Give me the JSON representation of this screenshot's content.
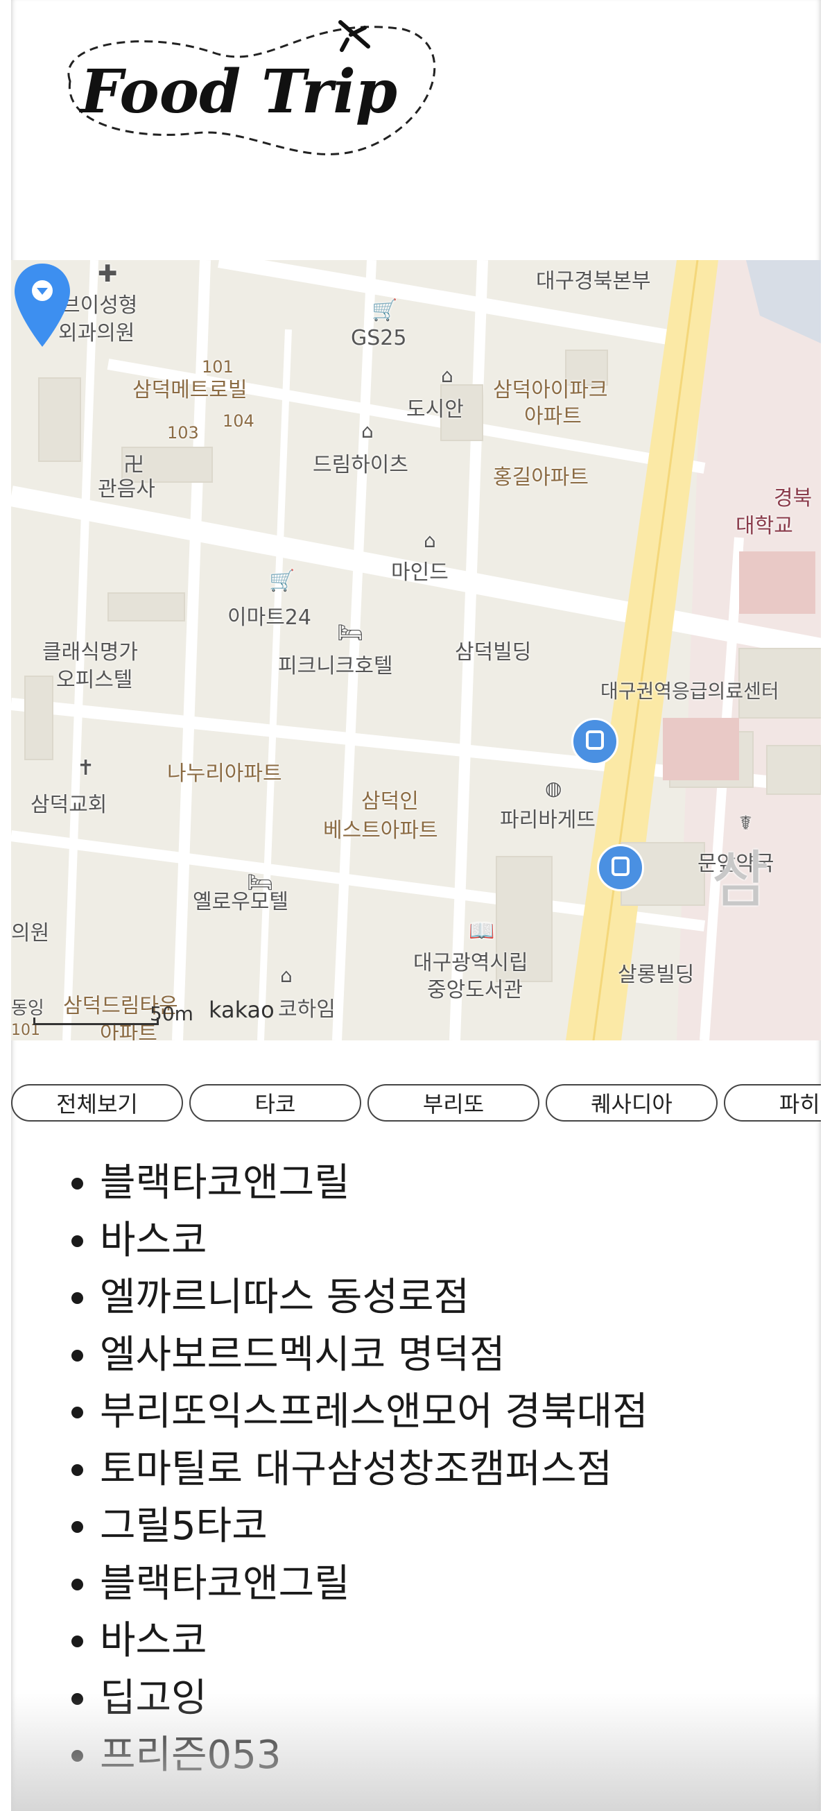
{
  "header": {
    "logo_text": "Food Trip"
  },
  "map": {
    "labels": [
      {
        "text": "대구경북본부",
        "cls": ""
      },
      {
        "text": "브이성형",
        "cls": ""
      },
      {
        "text": "외과의원",
        "cls": ""
      },
      {
        "text": "GS25",
        "cls": ""
      },
      {
        "text": "101",
        "cls": "brown"
      },
      {
        "text": "삼덕메트로빌",
        "cls": "brown"
      },
      {
        "text": "104",
        "cls": "brown"
      },
      {
        "text": "103",
        "cls": "brown"
      },
      {
        "text": "도시안",
        "cls": ""
      },
      {
        "text": "삼덕아이파크",
        "cls": "brown"
      },
      {
        "text": "아파트",
        "cls": "brown"
      },
      {
        "text": "드림하이츠",
        "cls": ""
      },
      {
        "text": "홍길아파트",
        "cls": "brown"
      },
      {
        "text": "관음사",
        "cls": ""
      },
      {
        "text": "경북",
        "cls": "red"
      },
      {
        "text": "대학교",
        "cls": "red"
      },
      {
        "text": "마인드",
        "cls": ""
      },
      {
        "text": "이마트24",
        "cls": ""
      },
      {
        "text": "클래식명가",
        "cls": ""
      },
      {
        "text": "오피스텔",
        "cls": ""
      },
      {
        "text": "피크니크호텔",
        "cls": ""
      },
      {
        "text": "삼덕빌딩",
        "cls": ""
      },
      {
        "text": "대구권역응급의료센터",
        "cls": ""
      },
      {
        "text": "나누리아파트",
        "cls": "brown"
      },
      {
        "text": "삼덕교회",
        "cls": ""
      },
      {
        "text": "삼덕인",
        "cls": "brown"
      },
      {
        "text": "베스트아파트",
        "cls": "brown"
      },
      {
        "text": "파리바게뜨",
        "cls": ""
      },
      {
        "text": "문앞약국",
        "cls": ""
      },
      {
        "text": "삼",
        "cls": "grey"
      },
      {
        "text": "옐로우모텔",
        "cls": ""
      },
      {
        "text": "의원",
        "cls": ""
      },
      {
        "text": "대구광역시립",
        "cls": ""
      },
      {
        "text": "중앙도서관",
        "cls": ""
      },
      {
        "text": "살롱빌딩",
        "cls": ""
      },
      {
        "text": "삼덕드림타운",
        "cls": "brown"
      },
      {
        "text": "아파트",
        "cls": "brown"
      },
      {
        "text": "코하임",
        "cls": ""
      },
      {
        "text": "101",
        "cls": "brown"
      },
      {
        "text": "동잉",
        "cls": ""
      }
    ],
    "scale_text": "50m",
    "provider_text": "kakao"
  },
  "tabs": [
    "전체보기",
    "타코",
    "부리또",
    "퀘사디아",
    "파히타"
  ],
  "restaurants": [
    "블랙타코앤그릴",
    "바스코",
    "엘까르니따스 동성로점",
    "엘사보르드멕시코 명덕점",
    "부리또익스프레스앤모어 경북대점",
    "토마틸로 대구삼성창조캠퍼스점",
    "그릴5타코",
    "블랙타코앤그릴",
    "바스코",
    "딥고잉",
    "프리즌053"
  ],
  "colors": {
    "map_background": "#f0eee6",
    "road": "#ffffff",
    "main_road": "#fbe9a6",
    "marker_blue": "#3d8ff0",
    "bus_blue": "#4a90e2"
  },
  "icons": [
    "logo-airplane-icon",
    "location-marker-icon",
    "bus-stop-icon",
    "convenience-store-icon",
    "hospital-icon",
    "building-icon",
    "hotel-icon",
    "church-icon",
    "bakery-icon",
    "pharmacy-icon",
    "library-icon",
    "temple-icon"
  ]
}
